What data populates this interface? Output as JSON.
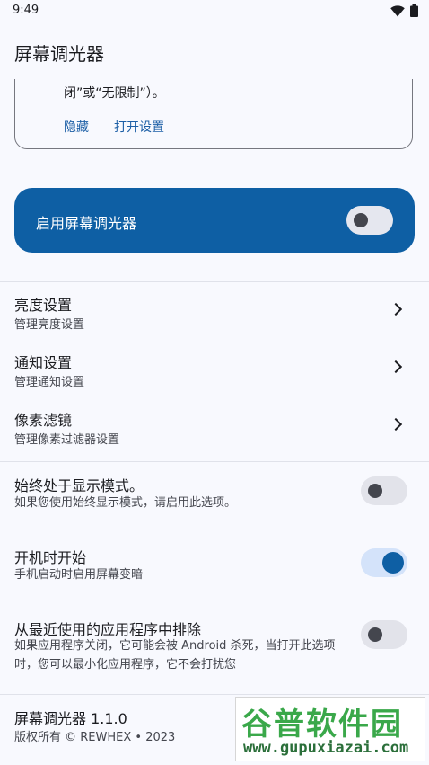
{
  "status": {
    "time": "9:49"
  },
  "app": {
    "title": "屏幕调光器"
  },
  "permission_card": {
    "text": "闭”或“无限制”）。",
    "hide_label": "隐藏",
    "open_settings_label": "打开设置"
  },
  "master": {
    "label": "启用屏幕调光器",
    "enabled": false
  },
  "nav_items": [
    {
      "title": "亮度设置",
      "subtitle": "管理亮度设置"
    },
    {
      "title": "通知设置",
      "subtitle": "管理通知设置"
    },
    {
      "title": "像素滤镜",
      "subtitle": "管理像素过滤器设置"
    }
  ],
  "toggles": [
    {
      "title": "始终处于显示模式。",
      "subtitle": "如果您使用始终显示模式，请启用此选项。",
      "on": false
    },
    {
      "title": "开机时开始",
      "subtitle": "手机启动时启用屏幕变暗",
      "on": true
    },
    {
      "title": "从最近使用的应用程序中排除",
      "subtitle": "如果应用程序关闭，它可能会被 Android 杀死，当打开此选项时，您可以最小化应用程序，它不会打扰您",
      "on": false
    }
  ],
  "footer": {
    "version": "屏幕调光器 1.1.0",
    "copyright": "版权所有 © REWHEX • 2023"
  },
  "watermark": {
    "logo": "谷普软件园",
    "url": "www.gupuxiazai.com"
  },
  "colors": {
    "primary": "#0e5fa4",
    "background": "#f8f9fe"
  }
}
